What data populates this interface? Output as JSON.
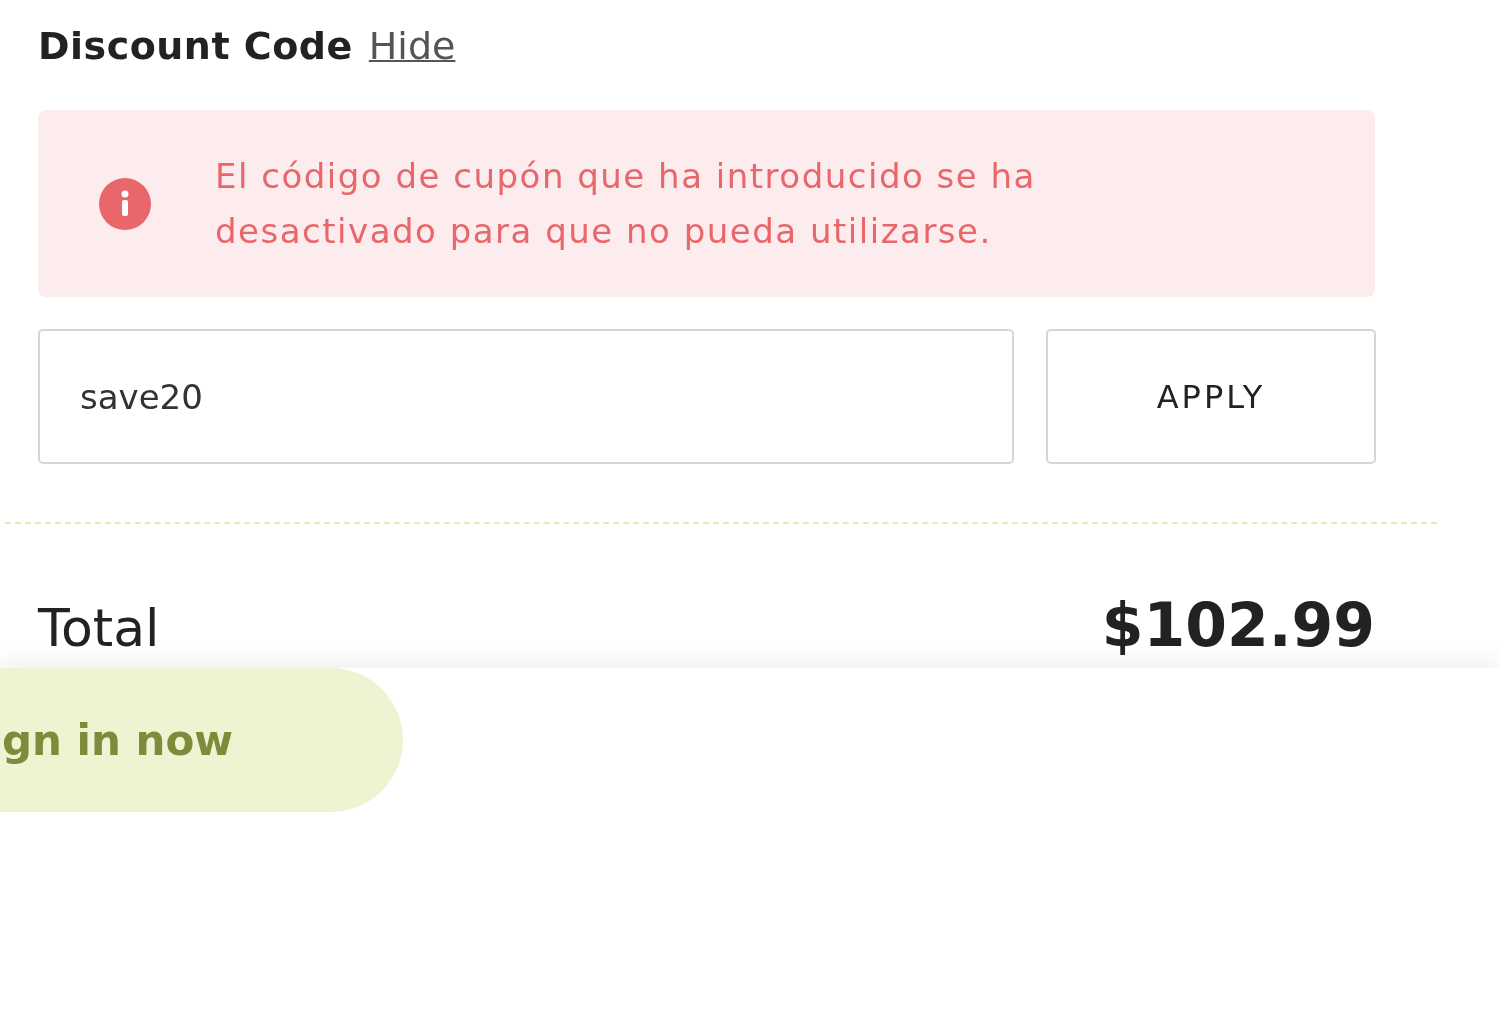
{
  "discount": {
    "title": "Discount Code",
    "toggle_link": "Hide"
  },
  "alert": {
    "kind": "error",
    "message": "El código de cupón que ha introducido se ha desactivado para que no pueda utilizarse."
  },
  "code_field": {
    "value": "save20"
  },
  "apply_button": "APPLY",
  "total": {
    "label": "Total",
    "amount": "$102.99"
  },
  "bottom_bar": {
    "sign_in_button": "gn in now"
  }
}
